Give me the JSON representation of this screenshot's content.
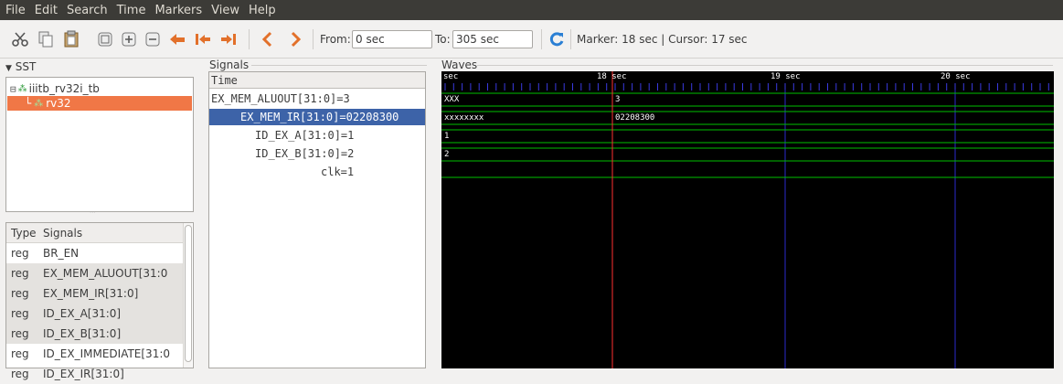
{
  "menu": [
    "File",
    "Edit",
    "Search",
    "Time",
    "Markers",
    "View",
    "Help"
  ],
  "toolbar": {
    "from_label": "From:",
    "from_value": "0 sec",
    "to_label": "To:",
    "to_value": "305 sec",
    "status": "Marker: 18 sec  |  Cursor: 17 sec"
  },
  "sst": {
    "title": "SST",
    "tree": [
      {
        "label": "iiitb_rv32i_tb",
        "selected": false
      },
      {
        "label": "rv32",
        "selected": true
      }
    ],
    "list_headers": {
      "type": "Type",
      "signals": "Signals"
    },
    "rows": [
      {
        "type": "reg",
        "signal": "BR_EN"
      },
      {
        "type": "reg",
        "signal": "EX_MEM_ALUOUT[31:0"
      },
      {
        "type": "reg",
        "signal": "EX_MEM_IR[31:0]"
      },
      {
        "type": "reg",
        "signal": "ID_EX_A[31:0]"
      },
      {
        "type": "reg",
        "signal": "ID_EX_B[31:0]"
      },
      {
        "type": "reg",
        "signal": "ID_EX_IMMEDIATE[31:0"
      },
      {
        "type": "reg",
        "signal": "ID_EX_IR[31:0]"
      }
    ]
  },
  "signals": {
    "title": "Signals",
    "header": "Time",
    "rows": [
      {
        "label": "EX_MEM_ALUOUT[31:0]=3",
        "selected": false
      },
      {
        "label": "EX_MEM_IR[31:0]=02208300",
        "selected": true
      },
      {
        "label": "ID_EX_A[31:0]=1",
        "selected": false
      },
      {
        "label": "ID_EX_B[31:0]=2",
        "selected": false
      },
      {
        "label": "clk=1",
        "selected": false
      }
    ]
  },
  "waves": {
    "title": "Waves",
    "time_labels": [
      "sec",
      "18 sec",
      "19 sec",
      "20 sec"
    ],
    "traces": [
      {
        "before": "XXX",
        "after": "3"
      },
      {
        "before": "xxxxxxxx",
        "after": "02208300"
      },
      {
        "before": "1",
        "after": ""
      },
      {
        "before": "2",
        "after": ""
      }
    ],
    "colors": {
      "bg": "#000000",
      "trace": "#00c000",
      "marker": "#ff3030",
      "grid": "#2a2acc",
      "selected": "#3d63a8"
    }
  }
}
